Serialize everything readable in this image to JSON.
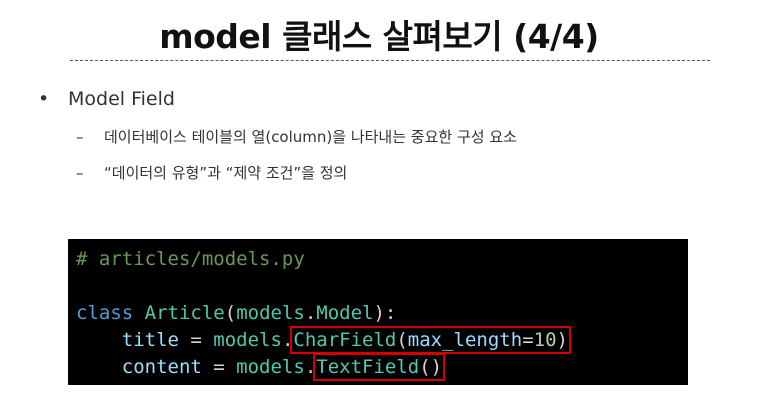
{
  "slide": {
    "title": "model 클래스 살펴보기 (4/4)",
    "bullet": {
      "marker": "•",
      "text": "Model Field",
      "subitems": [
        {
          "marker": "–",
          "text": "데이터베이스 테이블의 열(column)을 나타내는 중요한 구성 요소"
        },
        {
          "marker": "–",
          "text": "“데이터의 유형”과 “제약 조건”을 정의"
        }
      ]
    }
  },
  "code": {
    "comment": "# articles/models.py",
    "line3": {
      "kw": "class",
      "cls": "Article",
      "open": "(",
      "mod": "models",
      "dot": ".",
      "base": "Model",
      "close": "):"
    },
    "line4": {
      "indent": "    ",
      "name": "title",
      "eq": " = ",
      "mod": "models",
      "dot": ".",
      "field": "CharField",
      "open": "(",
      "arg": "max_length",
      "argeq": "=",
      "num": "10",
      "close": ")"
    },
    "line5": {
      "indent": "    ",
      "name": "content",
      "eq": " = ",
      "mod": "models",
      "dot": ".",
      "field": "TextField",
      "parens": "()"
    }
  },
  "colors": {
    "highlight_box": "#d40000",
    "code_background": "#000000"
  }
}
